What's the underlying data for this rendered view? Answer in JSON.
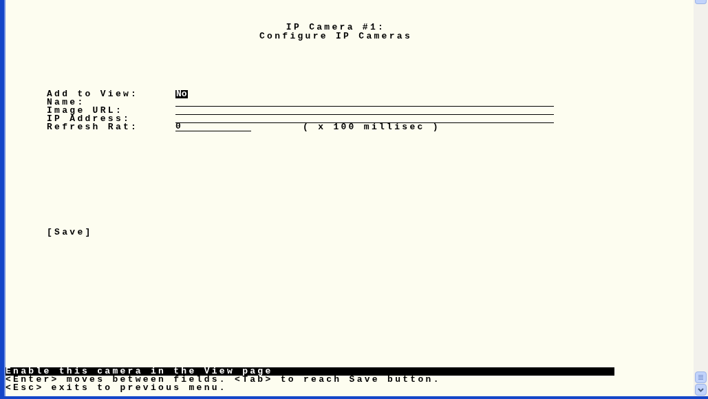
{
  "title": [
    "IP Camera #1:",
    "Configure IP Cameras"
  ],
  "fields": [
    {
      "kind": "toggle",
      "label": "Add to View:",
      "value": "No",
      "focused": true
    },
    {
      "kind": "text",
      "label": "Name:",
      "focused": false
    },
    {
      "kind": "text",
      "label": "Image URL:",
      "focused": false
    },
    {
      "kind": "text",
      "label": "IP Address:",
      "focused": false
    },
    {
      "kind": "number",
      "label": "Refresh Rat:",
      "value": "0",
      "unit": "( x 100 millisec )",
      "focused": false
    }
  ],
  "save_button": "[Save]",
  "status_line": "Enable this camera in the View page",
  "help_lines": [
    "<Enter> moves between fields. <Tab> to reach Save button.",
    "<Esc> exits to previous menu."
  ]
}
